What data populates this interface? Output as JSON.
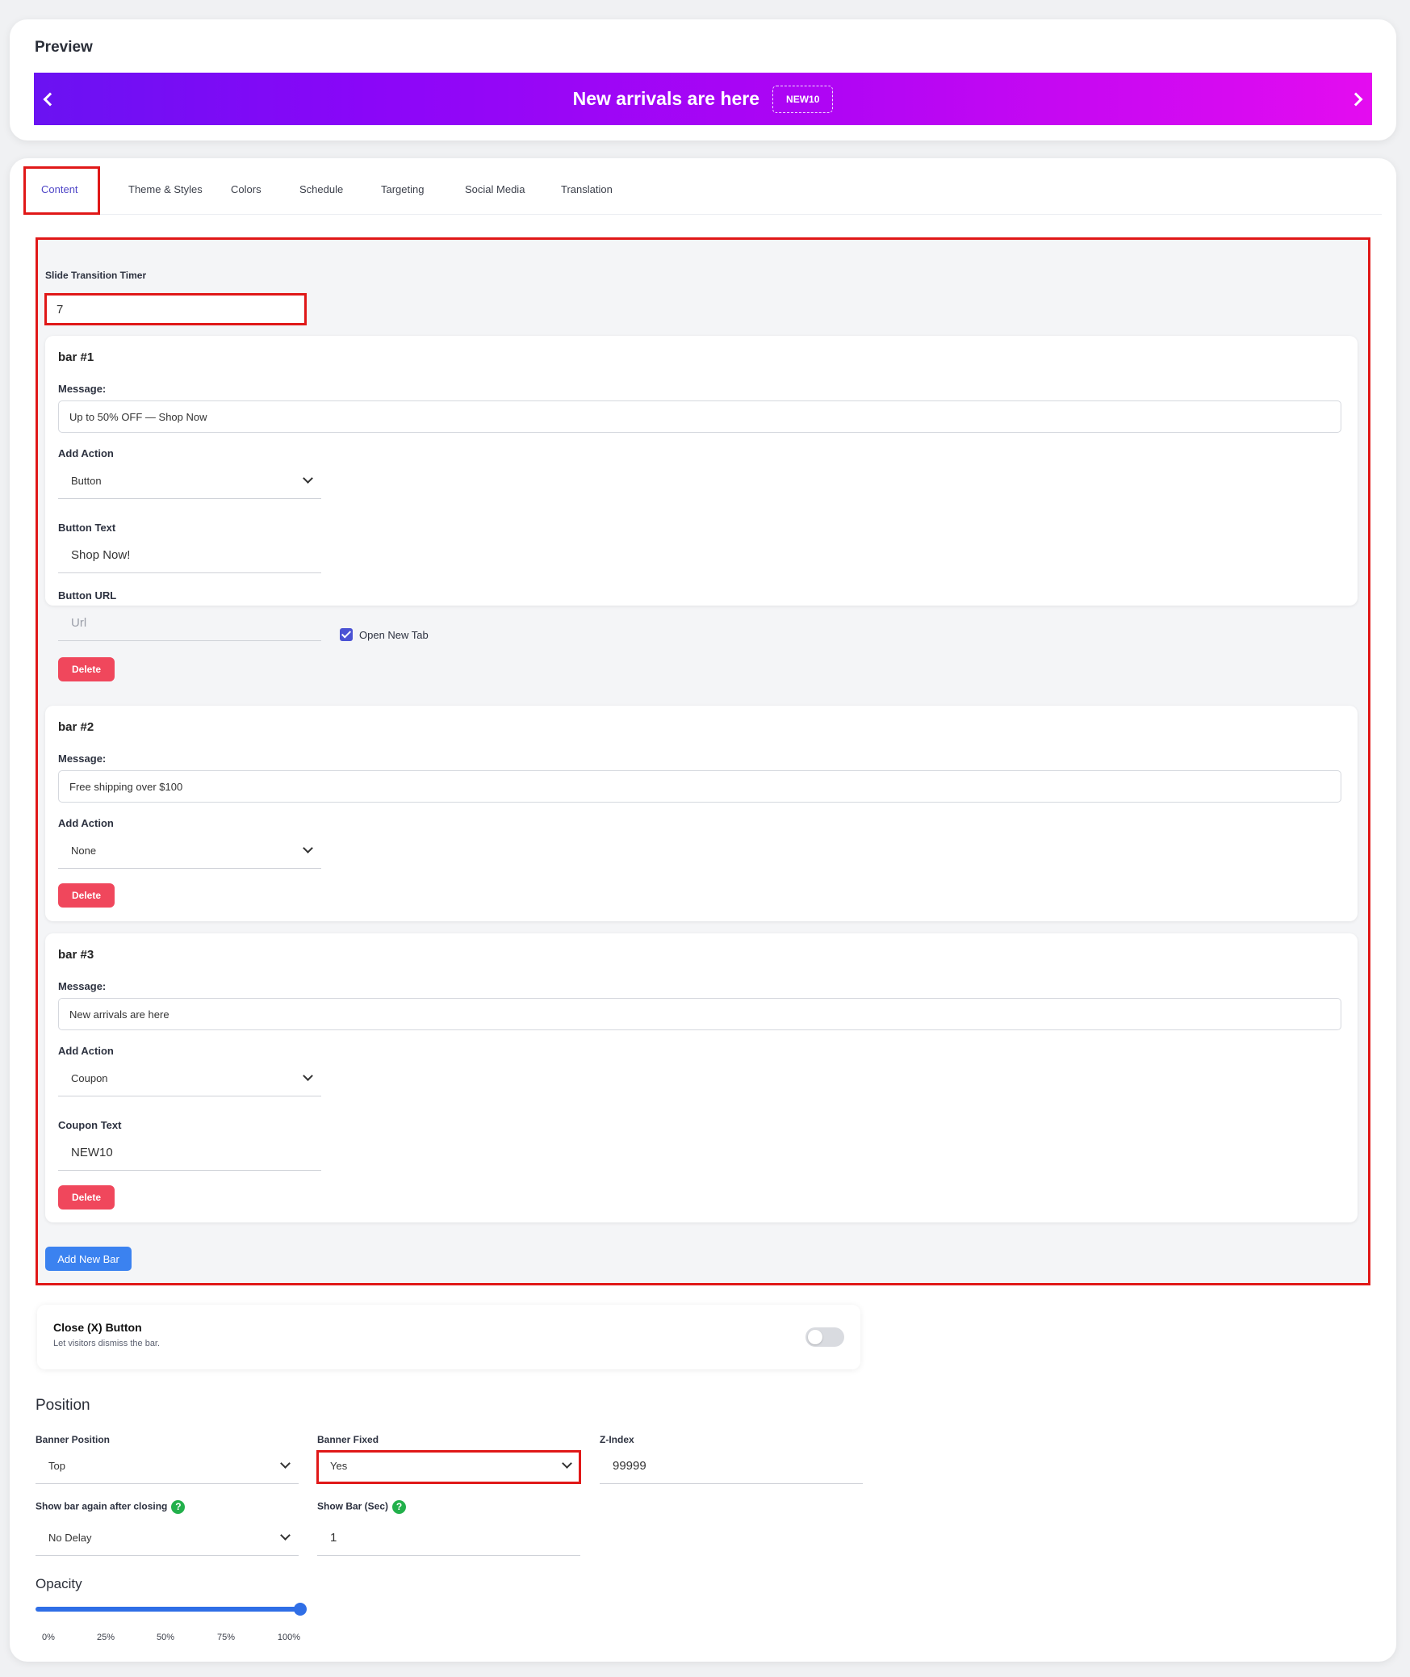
{
  "preview": {
    "title": "Preview",
    "message": "New arrivals are here",
    "coupon": "NEW10",
    "gradient_start": "#6a12f2",
    "gradient_end": "#e40cf0"
  },
  "tabs": [
    "Content",
    "Theme & Styles",
    "Colors",
    "Schedule",
    "Targeting",
    "Social Media",
    "Translation"
  ],
  "active_tab": "Content",
  "content": {
    "timer_label": "Slide Transition Timer",
    "timer_value": "7",
    "bars": [
      {
        "title": "bar #1",
        "message_label": "Message:",
        "message": "Up to 50% OFF — Shop Now",
        "action_label": "Add Action",
        "action": "Button",
        "button_text_label": "Button Text",
        "button_text": "Shop Now!",
        "button_url_label": "Button URL",
        "button_url_placeholder": "Url",
        "open_new_tab_label": "Open New Tab",
        "open_new_tab": true,
        "delete_label": "Delete"
      },
      {
        "title": "bar #2",
        "message_label": "Message:",
        "message": "Free shipping over $100",
        "action_label": "Add Action",
        "action": "None",
        "delete_label": "Delete"
      },
      {
        "title": "bar #3",
        "message_label": "Message:",
        "message": "New arrivals are here",
        "action_label": "Add Action",
        "action": "Coupon",
        "coupon_text_label": "Coupon Text",
        "coupon_text": "NEW10",
        "delete_label": "Delete"
      }
    ],
    "add_bar_label": "Add New Bar"
  },
  "close_button": {
    "title": "Close (X) Button",
    "description": "Let visitors dismiss the bar.",
    "enabled": false
  },
  "position": {
    "heading": "Position",
    "banner_position_label": "Banner Position",
    "banner_position": "Top",
    "banner_fixed_label": "Banner Fixed",
    "banner_fixed": "Yes",
    "z_index_label": "Z-Index",
    "z_index": "99999",
    "show_again_label": "Show bar again after closing",
    "show_again": "No Delay",
    "show_bar_sec_label": "Show Bar (Sec)",
    "show_bar_sec": "1",
    "help_icon": "?"
  },
  "opacity": {
    "heading": "Opacity",
    "value_percent": 100,
    "ticks": [
      "0%",
      "25%",
      "50%",
      "75%",
      "100%"
    ]
  },
  "colors": {
    "accent": "#4f46c7",
    "highlight": "#e01818",
    "delete": "#f0475c",
    "primary_button": "#3b82f0",
    "help": "#22b04b"
  }
}
